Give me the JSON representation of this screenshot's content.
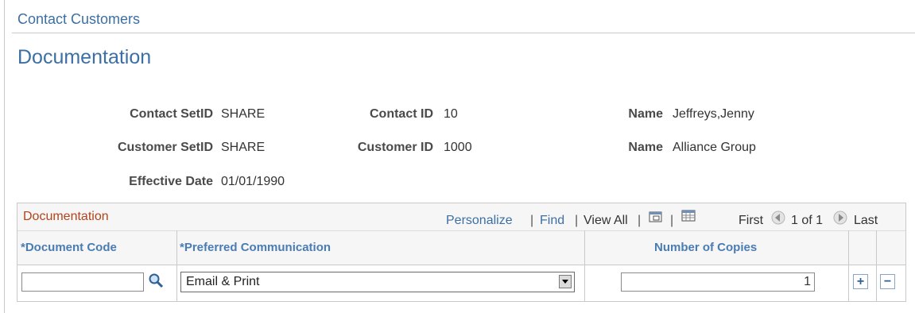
{
  "header": {
    "title": "Contact Customers"
  },
  "page": {
    "title": "Documentation"
  },
  "fields": {
    "contact_setid": {
      "label": "Contact SetID",
      "value": "SHARE"
    },
    "contact_id": {
      "label": "Contact ID",
      "value": "10"
    },
    "contact_name": {
      "label": "Name",
      "value": "Jeffreys,Jenny"
    },
    "customer_setid": {
      "label": "Customer SetID",
      "value": "SHARE"
    },
    "customer_id": {
      "label": "Customer ID",
      "value": "1000"
    },
    "customer_name": {
      "label": "Name",
      "value": "Alliance Group"
    },
    "effective_date": {
      "label": "Effective Date",
      "value": "01/01/1990"
    }
  },
  "grid": {
    "title": "Documentation",
    "toolbar": {
      "personalize": "Personalize",
      "find": "Find",
      "view_all": "View All",
      "sep": "|",
      "first": "First",
      "range": "1 of 1",
      "last": "Last"
    },
    "icons": {
      "zoom": "new-window-icon",
      "download": "grid-download-icon",
      "prev": "prev-arrow-icon",
      "next": "next-arrow-icon",
      "lookup": "magnifier-icon"
    },
    "columns": [
      "*Document Code",
      "*Preferred Communication",
      "Number of Copies"
    ],
    "rows": [
      {
        "document_code": "",
        "preferred_communication": "Email & Print",
        "copies": "1",
        "add": "+",
        "delete": "−"
      }
    ]
  },
  "colors": {
    "link": "#3c6fa3",
    "grid_title": "#b3441a",
    "column_header": "#4a7cb3"
  }
}
